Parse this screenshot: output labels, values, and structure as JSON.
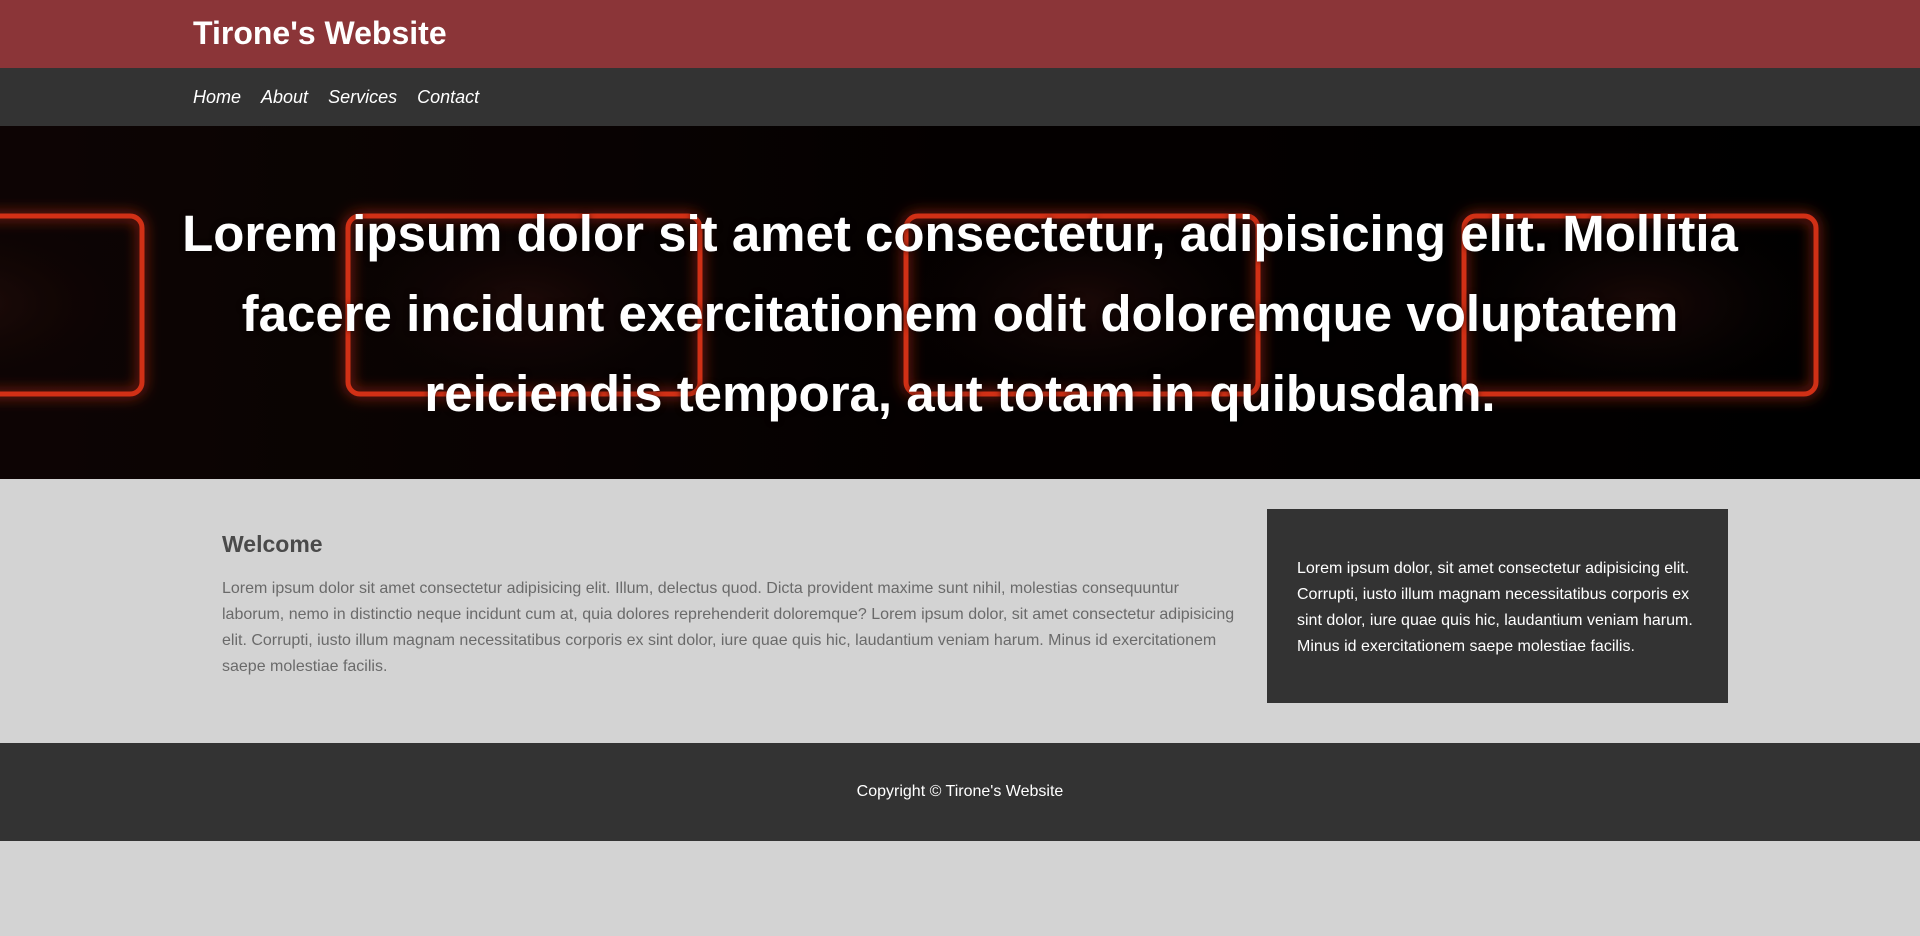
{
  "header": {
    "brand": "Tirone's Website"
  },
  "nav": {
    "items": [
      {
        "label": "Home"
      },
      {
        "label": "About"
      },
      {
        "label": "Services"
      },
      {
        "label": "Contact"
      }
    ]
  },
  "hero": {
    "heading": "Lorem ipsum dolor sit amet consectetur, adipisicing elit. Mollitia facere incidunt exercitationem odit doloremque voluptatem reiciendis tempora, aut totam in quibusdam.",
    "background_image": "neon-red-rounded-frames"
  },
  "main": {
    "title": "Welcome",
    "body": "Lorem ipsum dolor sit amet consectetur adipisicing elit. Illum, delectus quod. Dicta provident maxime sunt nihil, molestias consequuntur laborum, nemo in distinctio neque incidunt cum at, quia dolores reprehenderit doloremque? Lorem ipsum dolor, sit amet consectetur adipisicing elit. Corrupti, iusto illum magnam necessitatibus corporis ex sint dolor, iure quae quis hic, laudantium veniam harum. Minus id exercitationem saepe molestiae facilis."
  },
  "sidebar": {
    "body": "Lorem ipsum dolor, sit amet consectetur adipisicing elit. Corrupti, iusto illum magnam necessitatibus corporis ex sint dolor, iure quae quis hic, laudantium veniam harum. Minus id exercitationem saepe molestiae facilis."
  },
  "footer": {
    "copyright": "Copyright © Tirone's Website"
  },
  "colors": {
    "header_bg": "#8b3538",
    "nav_bg": "#333333",
    "page_bg": "#d3d3d3",
    "neon": "#ff3a1a"
  }
}
